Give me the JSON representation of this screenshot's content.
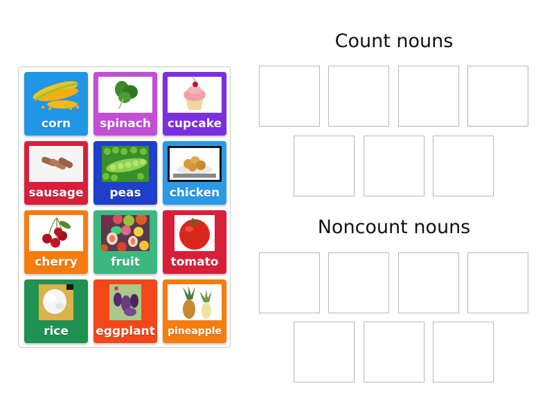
{
  "bank": {
    "tiles": [
      {
        "label": "corn",
        "color": "#2196e6",
        "image": "corn-image"
      },
      {
        "label": "spinach",
        "color": "#c24fd6",
        "image": "spinach-image"
      },
      {
        "label": "cupcake",
        "color": "#7b2fe0",
        "image": "cupcake-image"
      },
      {
        "label": "sausage",
        "color": "#d81f3a",
        "image": "sausage-image"
      },
      {
        "label": "peas",
        "color": "#1e3ecb",
        "image": "peas-image"
      },
      {
        "label": "chicken",
        "color": "#2a9ae6",
        "image": "chicken-image"
      },
      {
        "label": "cherry",
        "color": "#f57d10",
        "image": "cherry-image"
      },
      {
        "label": "fruit",
        "color": "#3cb77f",
        "image": "fruit-image"
      },
      {
        "label": "tomato",
        "color": "#d81f3a",
        "image": "tomato-image"
      },
      {
        "label": "rice",
        "color": "#1f9150",
        "image": "rice-image"
      },
      {
        "label": "eggplant",
        "color": "#f2461b",
        "image": "eggplant-image"
      },
      {
        "label": "pineapple",
        "color": "#f57d10",
        "image": "pineapple-image"
      }
    ]
  },
  "groups": [
    {
      "title": "Count nouns",
      "slots": 7
    },
    {
      "title": "Noncount nouns",
      "slots": 7
    }
  ]
}
